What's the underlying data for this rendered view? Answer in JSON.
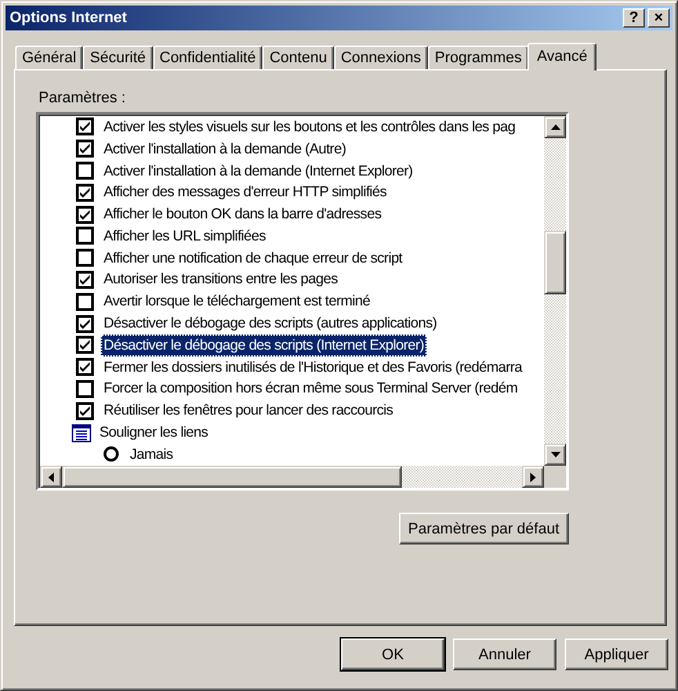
{
  "window": {
    "title": "Options Internet",
    "title_buttons": [
      "?",
      "×"
    ]
  },
  "tabs": [
    {
      "label": "Général",
      "selected": false
    },
    {
      "label": "Sécurité",
      "selected": false
    },
    {
      "label": "Confidentialité",
      "selected": false
    },
    {
      "label": "Contenu",
      "selected": false
    },
    {
      "label": "Connexions",
      "selected": false
    },
    {
      "label": "Programmes",
      "selected": false
    },
    {
      "label": "Avancé",
      "selected": true
    }
  ],
  "settings": {
    "label": "Paramètres :",
    "items": [
      {
        "kind": "checkbox",
        "label": "Activer les styles visuels sur les boutons et les contrôles dans les pag",
        "checked": true,
        "selected": false
      },
      {
        "kind": "checkbox",
        "label": "Activer l'installation à la demande (Autre)",
        "checked": true,
        "selected": false
      },
      {
        "kind": "checkbox",
        "label": "Activer l'installation à la demande (Internet Explorer)",
        "checked": false,
        "selected": false
      },
      {
        "kind": "checkbox",
        "label": "Afficher des messages d'erreur HTTP simplifiés",
        "checked": true,
        "selected": false
      },
      {
        "kind": "checkbox",
        "label": "Afficher le bouton OK dans la barre d'adresses",
        "checked": true,
        "selected": false
      },
      {
        "kind": "checkbox",
        "label": "Afficher les URL simplifiées",
        "checked": false,
        "selected": false
      },
      {
        "kind": "checkbox",
        "label": "Afficher une notification de chaque erreur de script",
        "checked": false,
        "selected": false
      },
      {
        "kind": "checkbox",
        "label": "Autoriser les transitions entre les pages",
        "checked": true,
        "selected": false
      },
      {
        "kind": "checkbox",
        "label": "Avertir lorsque le téléchargement est terminé",
        "checked": false,
        "selected": false
      },
      {
        "kind": "checkbox",
        "label": "Désactiver le débogage des scripts (autres applications)",
        "checked": true,
        "selected": false
      },
      {
        "kind": "checkbox",
        "label": "Désactiver le débogage des scripts (Internet Explorer)",
        "checked": true,
        "selected": true
      },
      {
        "kind": "checkbox",
        "label": "Fermer les dossiers inutilisés de l'Historique et des Favoris (redémarra",
        "checked": true,
        "selected": false
      },
      {
        "kind": "checkbox",
        "label": "Forcer la composition hors écran même sous Terminal Server (redém",
        "checked": false,
        "selected": false
      },
      {
        "kind": "checkbox",
        "label": "Réutiliser les fenêtres pour lancer des raccourcis",
        "checked": true,
        "selected": false
      },
      {
        "kind": "group",
        "label": "Souligner les liens",
        "selected": false
      },
      {
        "kind": "radio",
        "label": "Jamais",
        "checked": false,
        "selected": false
      }
    ]
  },
  "reset_button": "Paramètres par défaut",
  "buttons": [
    {
      "label": "OK",
      "default": true
    },
    {
      "label": "Annuler",
      "default": false
    },
    {
      "label": "Appliquer",
      "default": false
    }
  ]
}
